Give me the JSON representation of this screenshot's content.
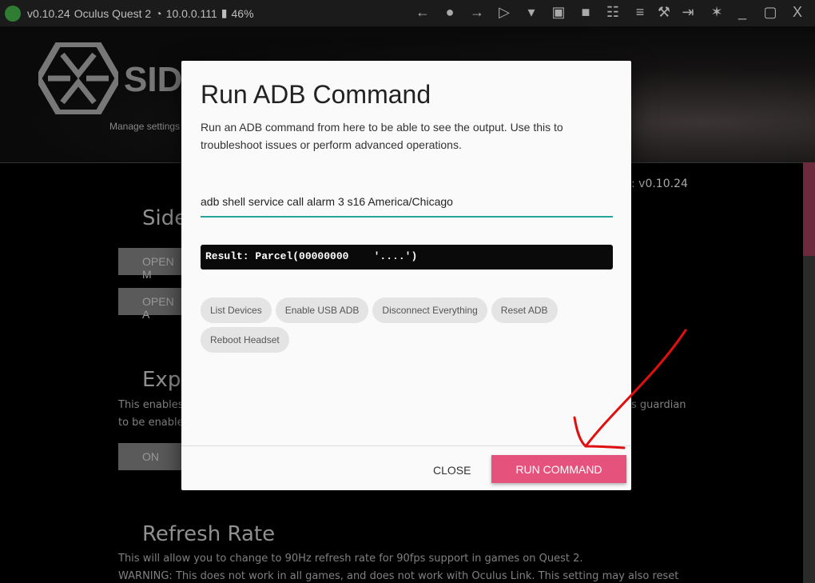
{
  "statusbar": {
    "version": "v0.10.24",
    "device": "Oculus Quest 2",
    "ip": "10.0.0.111",
    "battery": "46%",
    "connected_color": "#2e7d32",
    "icons": [
      "back-icon",
      "globe-icon",
      "forward-icon",
      "tv-icon",
      "wifi-icon",
      "download-box-icon",
      "folder-icon",
      "grid-icon",
      "checklist-icon",
      "wrench-icon",
      "login-icon",
      "bug-icon",
      "minimize-icon",
      "maximize-icon",
      "close-icon"
    ]
  },
  "header": {
    "logo_text": "SID",
    "tagline": "Manage settings"
  },
  "background": {
    "version_fragment": ": v0.10.24",
    "heading1": "Side",
    "btn1": "OPEN M",
    "btn2": "OPEN A",
    "heading2": "Expe",
    "text2a": "This enables",
    "text2b": "to be enable",
    "text2c": "s guardian",
    "btn3": "ON",
    "heading3": "Refresh Rate",
    "text3a": "This will allow you to change to 90Hz refresh rate for 90fps support in games on Quest 2.",
    "text3b": "WARNING: This does not work in all games, and does not work with Oculus Link. This setting may also reset"
  },
  "dialog": {
    "title": "Run ADB Command",
    "description": "Run an ADB command from here to be able to see the output. Use this to troubleshoot issues or perform advanced operations.",
    "command_value": "adb shell service call alarm 3 s16 America/Chicago",
    "result": "Result: Parcel(00000000    '....')",
    "chips": [
      "List Devices",
      "Enable USB ADB",
      "Disconnect Everything",
      "Reset ADB",
      "Reboot Headset"
    ],
    "close_label": "CLOSE",
    "run_label": "RUN COMMAND",
    "accent": "#e5527b",
    "input_color": "#26a69a"
  },
  "annotation": {
    "arrow_color": "#e01010"
  }
}
